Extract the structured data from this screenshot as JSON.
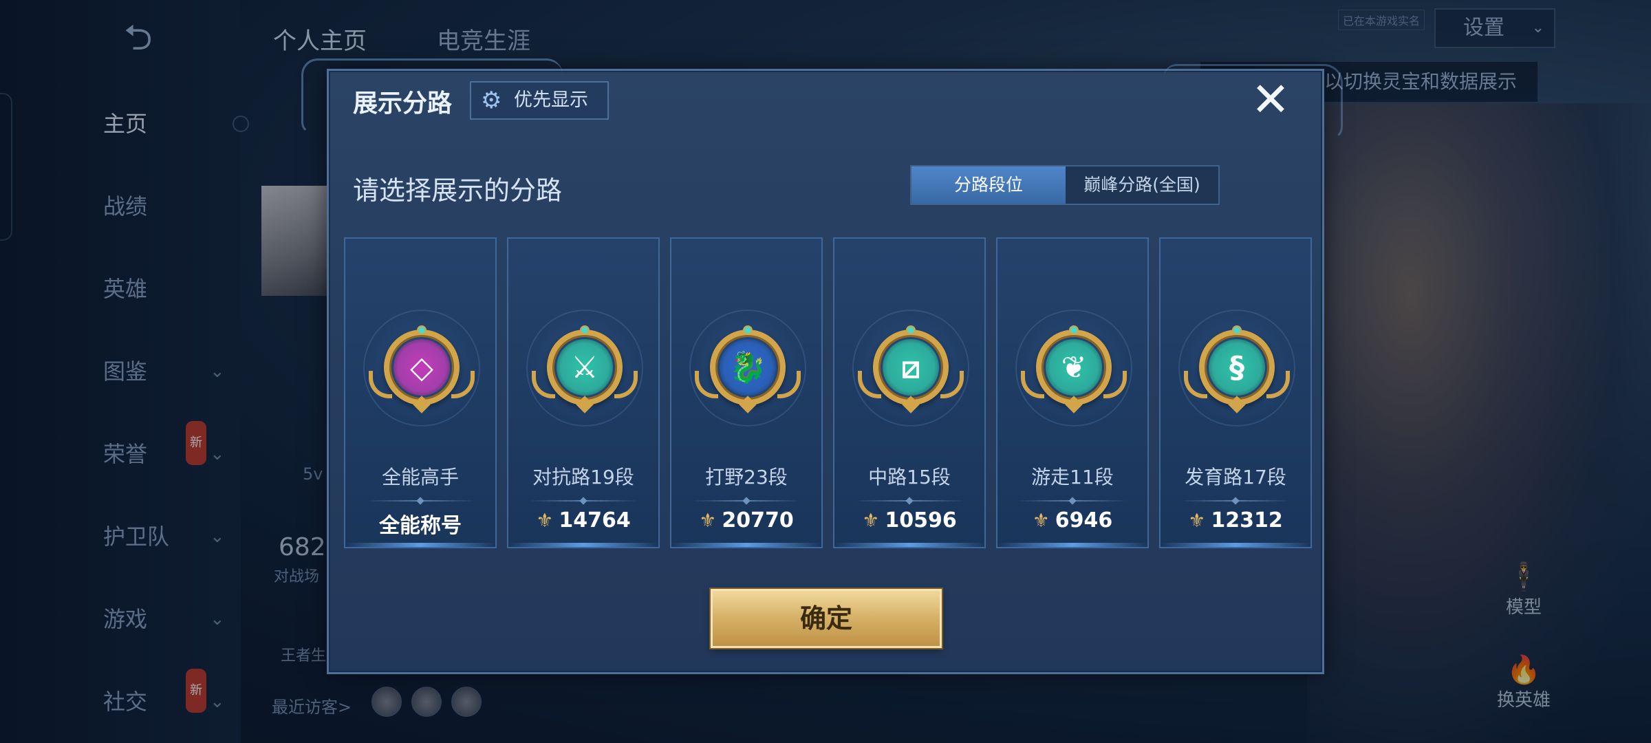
{
  "background": {
    "top_tabs": [
      "个人主页",
      "电竞生涯"
    ],
    "settings_label": "设置",
    "small_hint": "已在本游戏实名",
    "hint": "以切换灵宝和数据展示",
    "nav": [
      {
        "label": "主页",
        "chevron": false,
        "badge": ""
      },
      {
        "label": "战绩",
        "chevron": false,
        "badge": ""
      },
      {
        "label": "英雄",
        "chevron": false,
        "badge": ""
      },
      {
        "label": "图鉴",
        "chevron": true,
        "badge": ""
      },
      {
        "label": "荣誉",
        "chevron": true,
        "badge": "新"
      },
      {
        "label": "护卫队",
        "chevron": true,
        "badge": ""
      },
      {
        "label": "游戏",
        "chevron": true,
        "badge": ""
      },
      {
        "label": "社交",
        "chevron": true,
        "badge": "新"
      }
    ],
    "stat_number": "682",
    "stat_label": "对战场",
    "mode_label": "5v",
    "rank_label": "王者生",
    "recent_visitors": "最近访客>",
    "model_button": "模型",
    "switch_hero_button": "换英雄"
  },
  "modal": {
    "title": "展示分路",
    "priority_button": "优先显示",
    "close_symbol": "✕",
    "subtitle": "请选择展示的分路",
    "segments": [
      "分路段位",
      "巅峰分路(全国)"
    ],
    "active_segment": 0,
    "cards": [
      {
        "label": "全能高手",
        "value": "全能称号",
        "badge_icon": "all-round-badge-icon",
        "badge_color": "#c23cb8",
        "symbol": "◇",
        "has_points": false
      },
      {
        "label": "对抗路19段",
        "value": "14764",
        "badge_icon": "clash-lane-badge-icon",
        "badge_color": "#2fc3a6",
        "symbol": "⚔",
        "has_points": true
      },
      {
        "label": "打野23段",
        "value": "20770",
        "badge_icon": "jungle-badge-icon",
        "badge_color": "#2c66c8",
        "symbol": "🐉",
        "has_points": true
      },
      {
        "label": "中路15段",
        "value": "10596",
        "badge_icon": "mid-lane-badge-icon",
        "badge_color": "#2fc3a6",
        "symbol": "⧄",
        "has_points": true
      },
      {
        "label": "游走11段",
        "value": "6946",
        "badge_icon": "roam-badge-icon",
        "badge_color": "#2fc3a6",
        "symbol": "❦",
        "has_points": true
      },
      {
        "label": "发育路17段",
        "value": "12312",
        "badge_icon": "farm-lane-badge-icon",
        "badge_color": "#2fc3a6",
        "symbol": "§",
        "has_points": true
      }
    ],
    "confirm_button": "确定"
  }
}
